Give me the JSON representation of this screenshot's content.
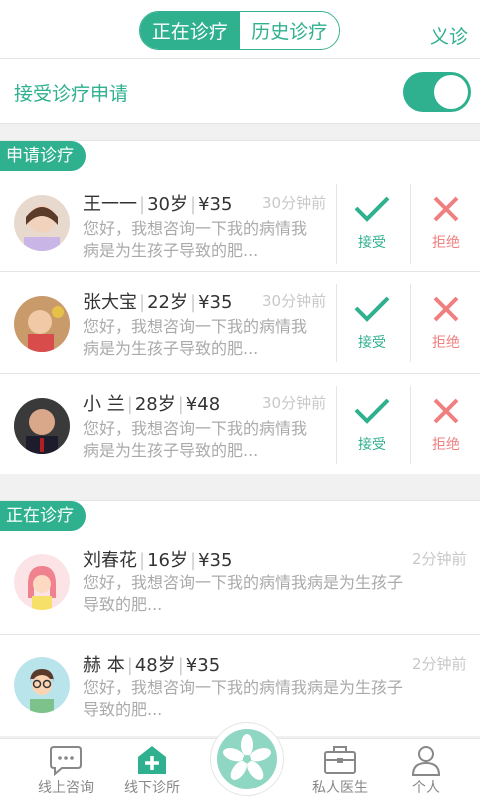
{
  "header": {
    "tab_active": "正在诊疗",
    "tab_inactive": "历史诊疗",
    "right_link": "义诊"
  },
  "accept_toggle": {
    "label": "接受诊疗申请",
    "on": true
  },
  "colors": {
    "accent": "#2fb08e",
    "reject": "#f08080"
  },
  "requests": {
    "section_title": "申请诊疗",
    "accept_label": "接受",
    "reject_label": "拒绝",
    "items": [
      {
        "name": "王一一",
        "age": "30岁",
        "fee": "¥35",
        "time": "30分钟前",
        "msg1": "您好，我想咨询一下我的病情我",
        "msg2": "病是为生孩子导致的肥..."
      },
      {
        "name": "张大宝",
        "age": "22岁",
        "fee": "¥35",
        "time": "30分钟前",
        "msg1": "您好，我想咨询一下我的病情我",
        "msg2": "病是为生孩子导致的肥..."
      },
      {
        "name": "小 兰",
        "age": "28岁",
        "fee": "¥48",
        "time": "30分钟前",
        "msg1": "您好，我想咨询一下我的病情我",
        "msg2": "病是为生孩子导致的肥..."
      }
    ]
  },
  "ongoing": {
    "section_title": "正在诊疗",
    "items": [
      {
        "name": "刘春花",
        "age": "16岁",
        "fee": "¥35",
        "time": "2分钟前",
        "msg1": "您好，我想咨询一下我的病情我病是为生孩子",
        "msg2": "导致的肥..."
      },
      {
        "name": "赫 本",
        "age": "48岁",
        "fee": "¥35",
        "time": "2分钟前",
        "msg1": "您好，我想咨询一下我的病情我病是为生孩子",
        "msg2": "导致的肥..."
      }
    ]
  },
  "tabbar": {
    "tabs": [
      {
        "label": "线上咨询",
        "icon": "chat-bubble-icon"
      },
      {
        "label": "线下诊所",
        "icon": "clinic-plus-icon"
      },
      {
        "label": "私人医生",
        "icon": "medical-kit-icon"
      },
      {
        "label": "个人",
        "icon": "person-icon"
      }
    ],
    "center_icon": "flower-icon"
  }
}
